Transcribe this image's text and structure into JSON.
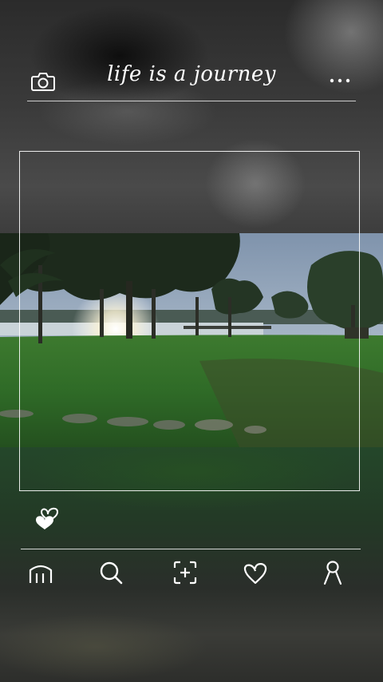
{
  "header": {
    "title": "life is a journey"
  },
  "icons": {
    "camera": "camera-icon",
    "more": "more-dots-icon",
    "like": "hearts-icon",
    "home": "home-icon",
    "search": "search-icon",
    "add": "add-frame-icon",
    "favorites": "heart-icon",
    "profile": "profile-icon"
  },
  "colors": {
    "foreground": "#ffffff",
    "grass": "#2f6b2a",
    "sky": "#b9c6d4"
  }
}
